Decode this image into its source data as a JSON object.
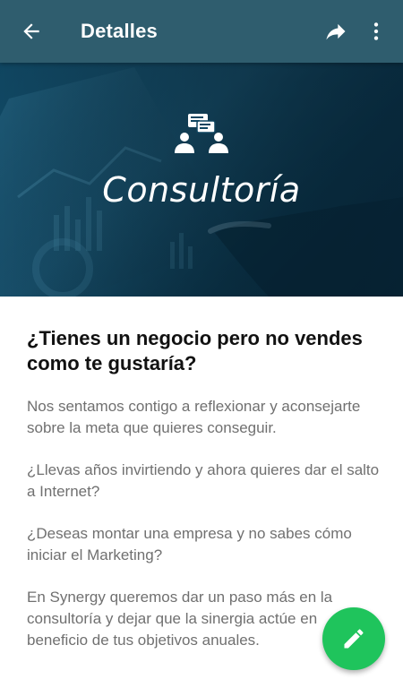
{
  "toolbar": {
    "title": "Detalles",
    "back_icon": "arrow-back-icon",
    "share_icon": "share-icon",
    "more_icon": "more-vert-icon",
    "background_color": "#2f5d6e"
  },
  "hero": {
    "title": "Consultoría",
    "icon": "consulting-people-chat-icon",
    "overlay_color": "#0f4560"
  },
  "content": {
    "heading": "¿Tienes un negocio pero no vendes como te gustaría?",
    "paragraphs": [
      "Nos sentamos contigo a reflexionar y aconsejarte sobre la meta que quieres conseguir.",
      "¿Llevas años invirtiendo y ahora quieres dar el salto a Internet?",
      "¿Deseas montar una empresa y no sabes cómo iniciar el Marketing?",
      "En Synergy queremos dar un paso más en la consultoría y dejar que la sinergia actúe en beneficio de tus objetivos anuales."
    ]
  },
  "fab": {
    "icon": "edit-pencil-icon",
    "color": "#1fc45c"
  }
}
